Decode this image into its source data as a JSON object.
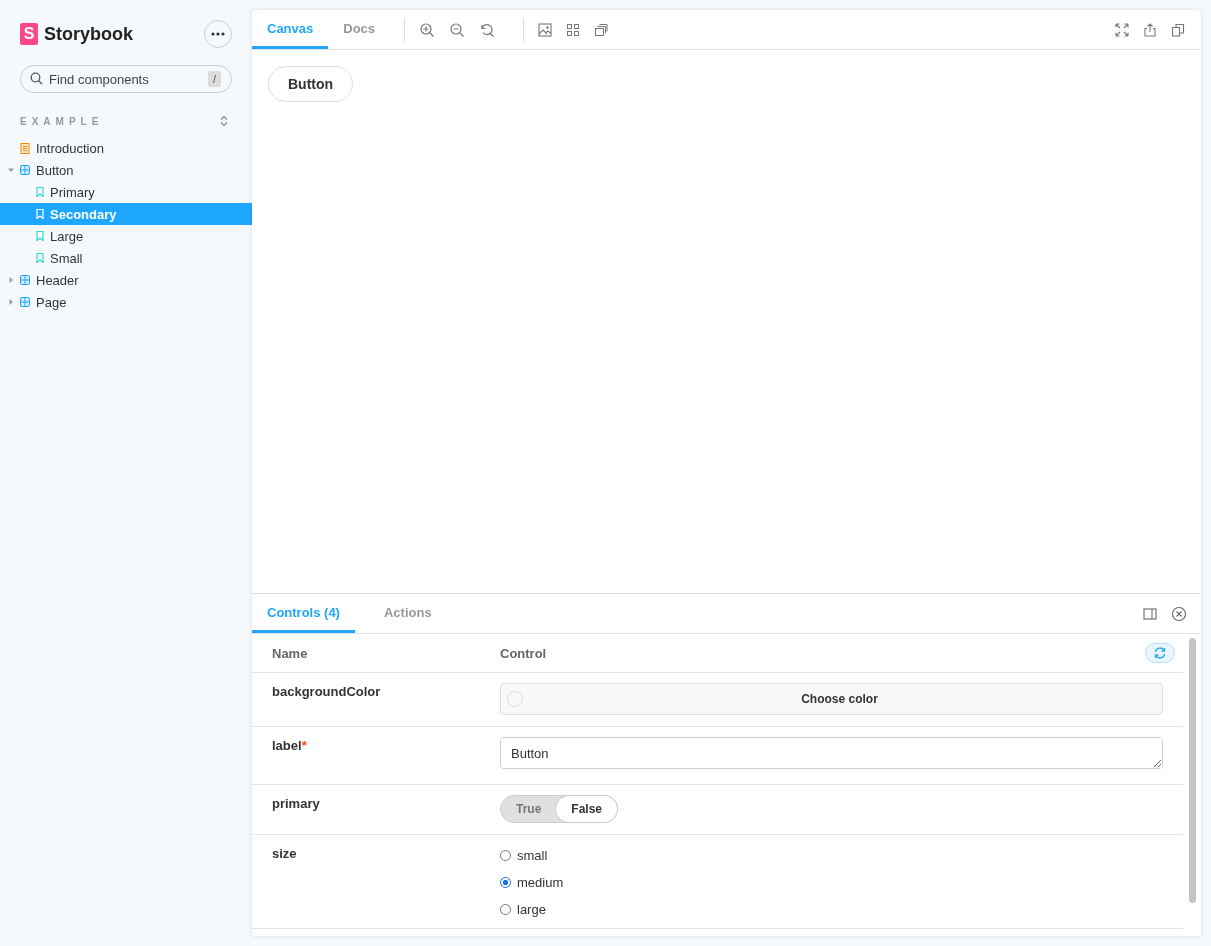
{
  "sidebar": {
    "logo_mark": "S",
    "brand": "Storybook",
    "search": {
      "placeholder": "Find components",
      "shortcut": "/"
    },
    "section": "EXAMPLE",
    "tree": [
      {
        "label": "Introduction",
        "kind": "doc",
        "selected": false
      },
      {
        "label": "Button",
        "kind": "component",
        "expanded": true,
        "selected": false,
        "children": [
          {
            "label": "Primary",
            "kind": "story",
            "selected": false
          },
          {
            "label": "Secondary",
            "kind": "story",
            "selected": true
          },
          {
            "label": "Large",
            "kind": "story",
            "selected": false
          },
          {
            "label": "Small",
            "kind": "story",
            "selected": false
          }
        ]
      },
      {
        "label": "Header",
        "kind": "component",
        "expanded": false,
        "selected": false
      },
      {
        "label": "Page",
        "kind": "component",
        "expanded": false,
        "selected": false
      }
    ]
  },
  "toolbar": {
    "tabs": [
      {
        "label": "Canvas",
        "selected": true
      },
      {
        "label": "Docs",
        "selected": false
      }
    ]
  },
  "preview": {
    "button": "Button"
  },
  "addons": {
    "tabs": [
      {
        "label": "Controls (4)",
        "selected": true
      },
      {
        "label": "Actions",
        "selected": false
      }
    ],
    "columns": [
      "Name",
      "Control"
    ],
    "rows": [
      {
        "name": "backgroundColor",
        "kind": "color",
        "value": "Choose color"
      },
      {
        "name": "label",
        "required_mark": "*",
        "kind": "text",
        "value": "Button"
      },
      {
        "name": "primary",
        "kind": "boolean",
        "options": [
          {
            "label": "True",
            "selected": false
          },
          {
            "label": "False",
            "selected": true
          }
        ]
      },
      {
        "name": "size",
        "kind": "radio",
        "options": [
          {
            "label": "small",
            "selected": false
          },
          {
            "label": "medium",
            "selected": true
          },
          {
            "label": "large",
            "selected": false
          }
        ]
      }
    ]
  }
}
